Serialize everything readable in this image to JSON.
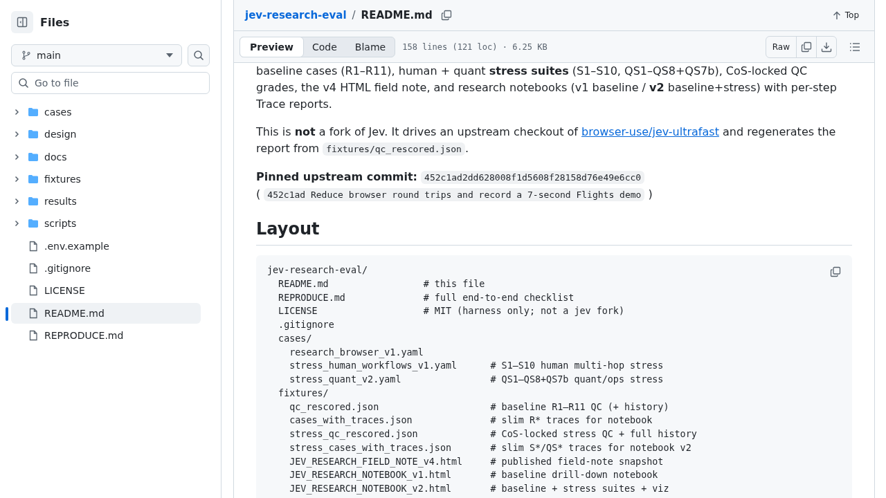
{
  "sidebar": {
    "title": "Files",
    "branch": "main",
    "search": {
      "placeholder": "Go to file"
    },
    "tree": [
      {
        "kind": "folder",
        "name": "cases",
        "expanded": false,
        "selected": false
      },
      {
        "kind": "folder",
        "name": "design",
        "expanded": false,
        "selected": false
      },
      {
        "kind": "folder",
        "name": "docs",
        "expanded": false,
        "selected": false
      },
      {
        "kind": "folder",
        "name": "fixtures",
        "expanded": false,
        "selected": false
      },
      {
        "kind": "folder",
        "name": "results",
        "expanded": false,
        "selected": false
      },
      {
        "kind": "folder",
        "name": "scripts",
        "expanded": false,
        "selected": false
      },
      {
        "kind": "file",
        "name": ".env.example",
        "selected": false
      },
      {
        "kind": "file",
        "name": ".gitignore",
        "selected": false
      },
      {
        "kind": "file",
        "name": "LICENSE",
        "selected": false
      },
      {
        "kind": "file",
        "name": "README.md",
        "selected": true
      },
      {
        "kind": "file",
        "name": "REPRODUCE.md",
        "selected": false
      }
    ]
  },
  "breadcrumb": {
    "repo": "jev-research-eval",
    "separator": "/",
    "file": "README.md",
    "top": "Top"
  },
  "toolbar": {
    "tabs": [
      {
        "label": "Preview",
        "selected": true
      },
      {
        "label": "Code",
        "selected": false
      },
      {
        "label": "Blame",
        "selected": false
      }
    ],
    "info": "158 lines (121 loc) · 6.25 KB",
    "raw": "Raw"
  },
  "content": {
    "paragraphs": [
      [
        {
          "kind": "text",
          "text": "baseline cases (R1–R11), human + quant **stress suites** (S1–S10, QS1–QS8+QS7b), CoS-locked QC grades, the v4 HTML field note, and research notebooks (v1 baseline / **v2** baseline+stress) with per-step Trace reports."
        }
      ],
      [
        {
          "kind": "text",
          "text": "This is **not** a fork of Jev. It drives an upstream checkout of "
        },
        {
          "kind": "link",
          "text": "browser-use/jev-ultrafast"
        },
        {
          "kind": "text",
          "text": " and regenerates the report from "
        },
        {
          "kind": "code",
          "text": "fixtures/qc_rescored.json"
        },
        {
          "kind": "text",
          "text": "."
        }
      ],
      [
        {
          "kind": "text",
          "text": "**Pinned upstream commit:** "
        },
        {
          "kind": "code",
          "text": "452c1ad2dd628008f1d5608f28158d76e49e6cc0"
        },
        {
          "kind": "break"
        },
        {
          "kind": "text",
          "text": "( "
        },
        {
          "kind": "code",
          "text": "452c1ad Reduce browser round trips and record a 7-second Flights demo"
        },
        {
          "kind": "text",
          "text": " )"
        }
      ]
    ],
    "heading": "Layout",
    "code_lines": [
      "jev-research-eval/",
      "  README.md                 # this file",
      "  REPRODUCE.md              # full end-to-end checklist",
      "  LICENSE                   # MIT (harness only; not a jev fork)",
      "  .gitignore",
      "  cases/",
      "    research_browser_v1.yaml",
      "    stress_human_workflows_v1.yaml      # S1–S10 human multi-hop stress",
      "    stress_quant_v2.yaml                # QS1–QS8+QS7b quant/ops stress",
      "  fixtures/",
      "    qc_rescored.json                    # baseline R1–R11 QC (+ history)",
      "    cases_with_traces.json              # slim R* traces for notebook",
      "    stress_qc_rescored.json             # CoS-locked stress QC + full history",
      "    stress_cases_with_traces.json       # slim S*/QS* traces for notebook v2",
      "    JEV_RESEARCH_FIELD_NOTE_v4.html     # published field-note snapshot",
      "    JEV_RESEARCH_NOTEBOOK_v1.html       # baseline drill-down notebook",
      "    JEV_RESEARCH_NOTEBOOK_v2.html       # baseline + stress suites + viz"
    ]
  }
}
